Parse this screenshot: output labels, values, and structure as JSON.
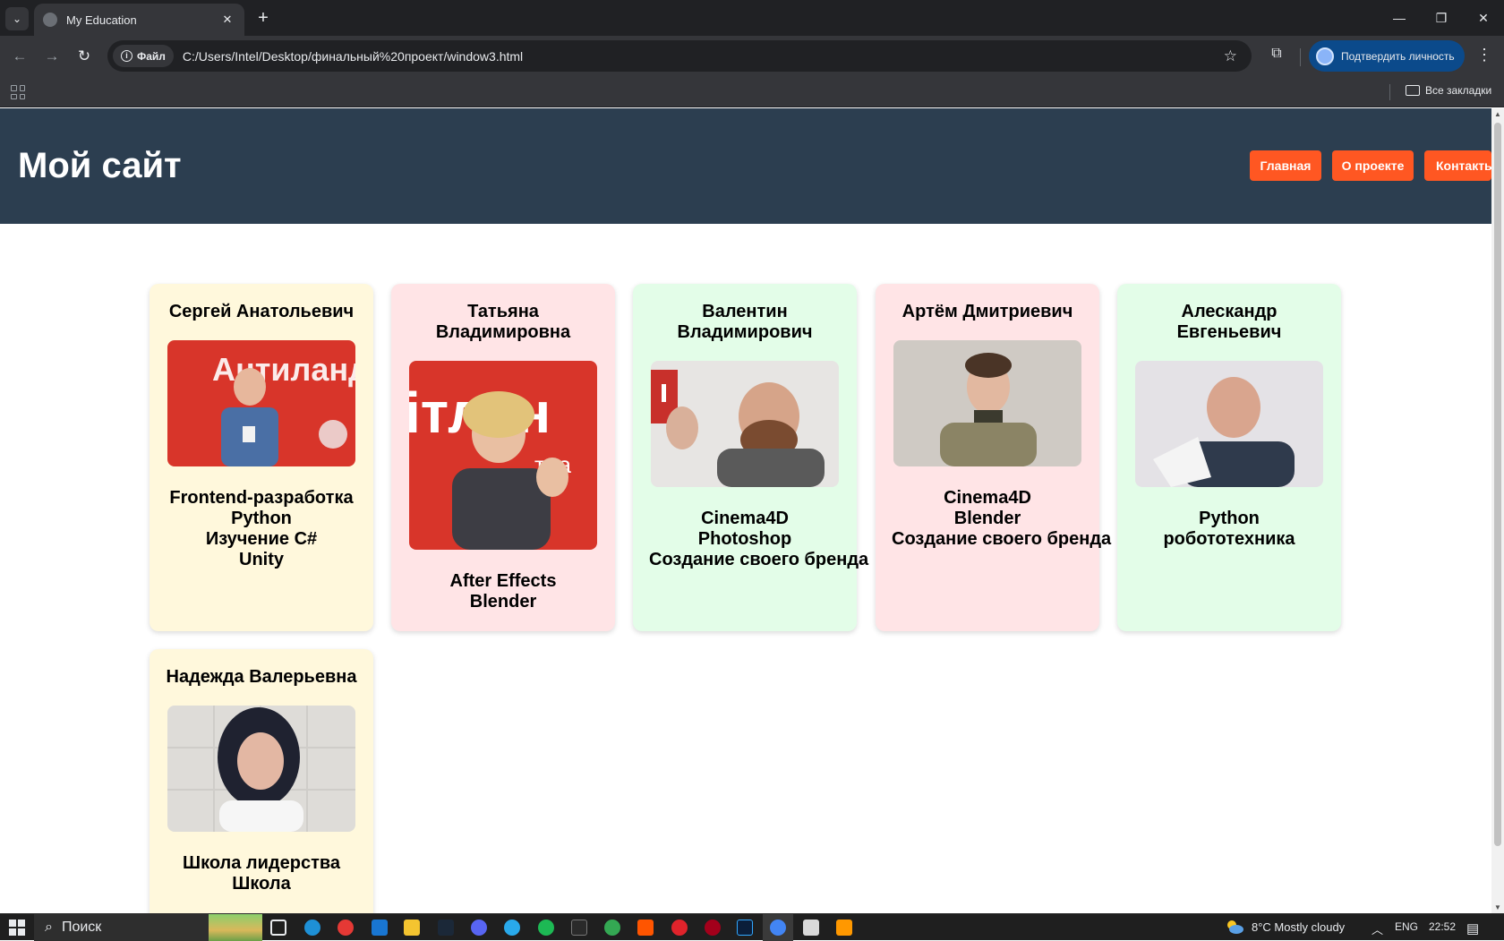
{
  "browser": {
    "tab_title": "My Education",
    "new_tab": "+",
    "close_tab": "✕",
    "win_minimize": "—",
    "win_restore": "❐",
    "win_close": "✕",
    "site_chip": "Файл",
    "url": "C:/Users/Intel/Desktop/финальный%20проект/window3.html",
    "profile_label": "Подтвердить личность",
    "all_bookmarks": "Все закладки"
  },
  "site": {
    "title": "Мой сайт",
    "nav": [
      {
        "label": "Главная"
      },
      {
        "label": "О проекте"
      },
      {
        "label": "Контакты"
      }
    ],
    "colors": {
      "header_bg": "#2c3e50",
      "nav_button": "#ff5722",
      "card_yellow": "#fff8dc",
      "card_pink": "#ffe4e6",
      "card_green": "#e3fde8"
    }
  },
  "teachers": [
    {
      "name": "Сергей Анатольевич",
      "courses": [
        "Frontend-разработка",
        "Python",
        "Изучение C#",
        "Unity"
      ],
      "photo": "teacher-photo-red-banner"
    },
    {
      "name": "Татьяна Владимировна",
      "courses": [
        "After Effects",
        "Blender"
      ],
      "photo": "teacher-photo-red-banner"
    },
    {
      "name": "Валентин Владимирович",
      "courses": [
        "Cinema4D",
        "Photoshop",
        "Создание своего бренда"
      ],
      "photo": "teacher-photo-gray-wall"
    },
    {
      "name": "Артём Дмитриевич",
      "courses": [
        "Cinema4D",
        "Blender",
        "Создание своего бренда"
      ],
      "photo": "teacher-photo-gray-wall"
    },
    {
      "name": "Алескандр Евгеньевич",
      "courses": [
        "Python",
        "робототехника"
      ],
      "photo": "teacher-photo-white-wall"
    },
    {
      "name": "Надежда Валерьевна",
      "courses": [
        "Школа лидерства",
        "Школа"
      ],
      "photo": "teacher-photo-tiled-wall"
    }
  ],
  "taskbar": {
    "search_label": "Поиск",
    "weather": "8°C  Mostly cloudy",
    "language": "ENG",
    "time": "22:52"
  }
}
